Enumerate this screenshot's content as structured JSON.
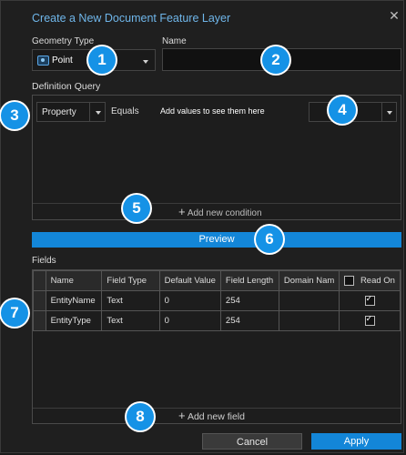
{
  "dialog": {
    "title": "Create a New Document Feature Layer",
    "close_glyph": "✕"
  },
  "geometry": {
    "label": "Geometry Type",
    "value": "Point",
    "icon": "point-layer-icon"
  },
  "name": {
    "label": "Name",
    "value": ""
  },
  "definition_query": {
    "label": "Definition Query",
    "property": "Property",
    "operator": "Equals",
    "values_hint": "Add values to see them here",
    "add_condition": "Add new condition"
  },
  "preview_label": "Preview",
  "fields": {
    "label": "Fields",
    "columns": [
      "Name",
      "Field Type",
      "Default Value",
      "Field Length",
      "Domain Nam",
      "Read On"
    ],
    "rows": [
      {
        "name": "EntityName",
        "type": "Text",
        "default": "0",
        "length": "254",
        "domain": "",
        "read_only": true
      },
      {
        "name": "EntityType",
        "type": "Text",
        "default": "0",
        "length": "254",
        "domain": "",
        "read_only": true
      }
    ],
    "add_field": "Add new field"
  },
  "buttons": {
    "cancel": "Cancel",
    "apply": "Apply"
  },
  "badges": [
    "1",
    "2",
    "3",
    "4",
    "5",
    "6",
    "7",
    "8"
  ],
  "colors": {
    "accent": "#1592e6",
    "title": "#6fb6ea",
    "background": "#1f1f1f"
  }
}
